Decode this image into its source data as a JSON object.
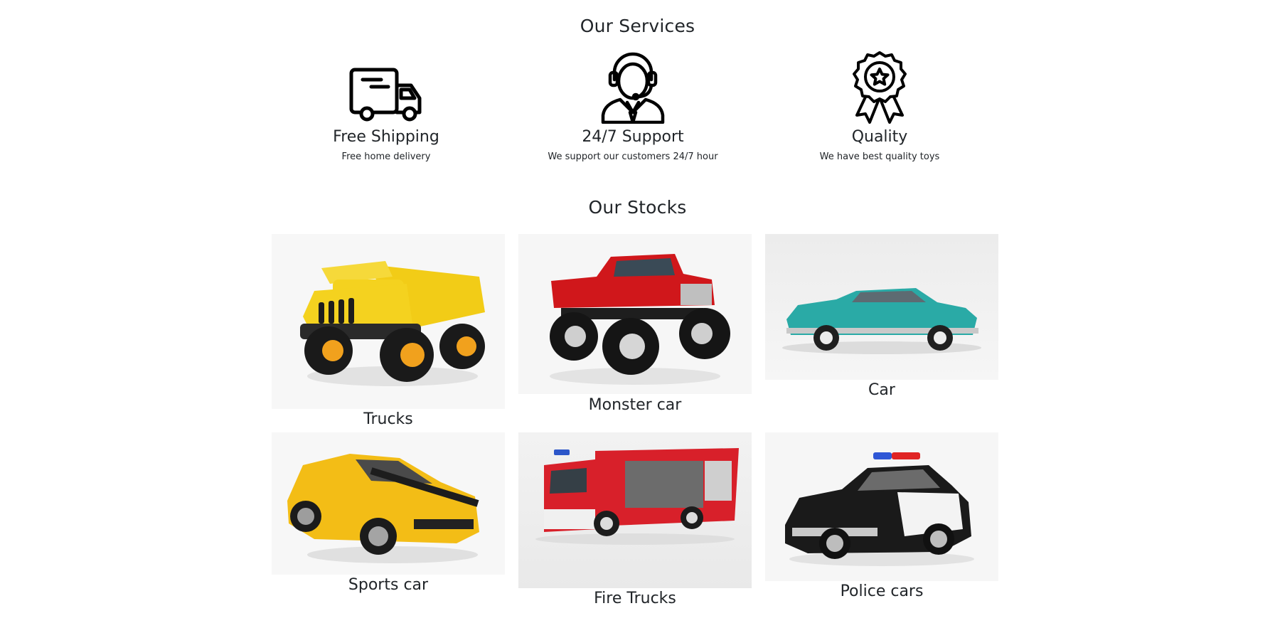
{
  "services": {
    "title": "Our Services",
    "items": [
      {
        "icon": "delivery-truck-icon",
        "title": "Free Shipping",
        "description": "Free home delivery"
      },
      {
        "icon": "support-agent-icon",
        "title": "24/7 Support",
        "description": "We support our customers 24/7 hour"
      },
      {
        "icon": "quality-badge-icon",
        "title": "Quality",
        "description": "We have best quality toys"
      }
    ]
  },
  "stocks": {
    "title": "Our Stocks",
    "items": [
      {
        "label": "Trucks",
        "image": "yellow-toy-dump-truck",
        "color": "#f4d21f"
      },
      {
        "label": "Monster car",
        "image": "red-toy-monster-truck",
        "color": "#d0171b"
      },
      {
        "label": "Car",
        "image": "teal-classic-toy-car",
        "color": "#2aaaa6"
      },
      {
        "label": "Sports car",
        "image": "yellow-toy-sports-car",
        "color": "#f3bd16"
      },
      {
        "label": "Fire Trucks",
        "image": "red-toy-fire-truck",
        "color": "#d8202a"
      },
      {
        "label": "Police cars",
        "image": "black-toy-police-car",
        "color": "#1a1a1a"
      }
    ]
  }
}
